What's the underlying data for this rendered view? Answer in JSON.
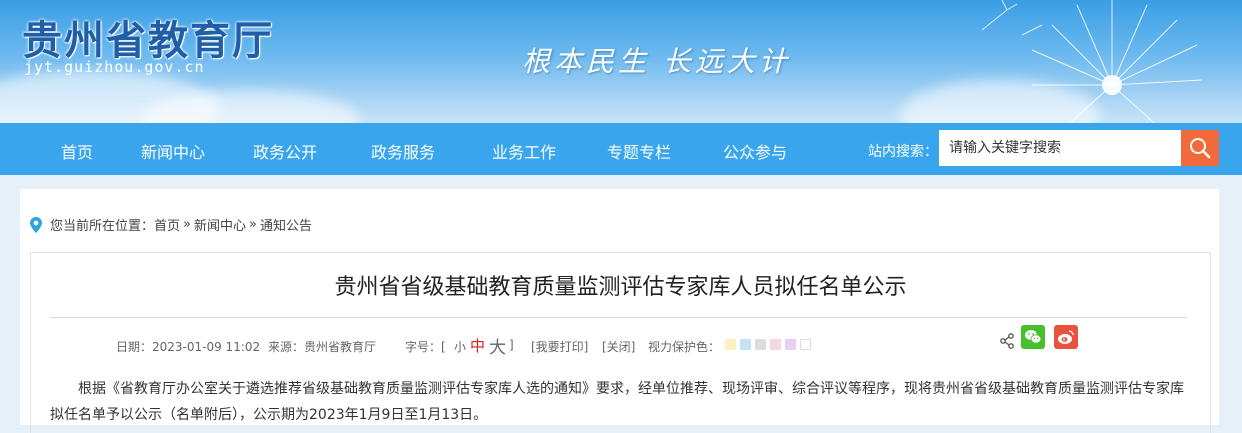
{
  "header": {
    "site_title": "贵州省教育厅",
    "site_domain": "jyt.guizhou.gov.cn",
    "slogan": "根本民生 长远大计"
  },
  "nav": {
    "items": [
      "首页",
      "新闻中心",
      "政务公开",
      "政务服务",
      "业务工作",
      "专题专栏",
      "公众参与"
    ],
    "search_label": "站内搜索：",
    "search_placeholder": "请输入关键字搜索"
  },
  "breadcrumb": {
    "prefix": "您当前所在位置：",
    "items": [
      "首页",
      "新闻中心",
      "通知公告"
    ],
    "separator": "»"
  },
  "article": {
    "title": "贵州省省级基础教育质量监测评估专家库人员拟任名单公示",
    "date": "日期：2023-01-09 11:02",
    "source": "来源：贵州省教育厅",
    "font_size_label": "字号：[",
    "font_small": "小",
    "font_medium": "中",
    "font_large": "大",
    "font_close": "]",
    "print": "[我要打印]",
    "close": "[关闭]",
    "eye_care_label": "视力保护色：",
    "eye_care_colors": [
      "#faf2c5",
      "#c4e3f6",
      "#dcdcdc",
      "#f5d7dd",
      "#e5d2f2",
      "#ffffff"
    ],
    "body": "根据《省教育厅办公室关于遴选推荐省级基础教育质量监测评估专家库人选的通知》要求，经单位推荐、现场评审、综合评议等程序，现将贵州省省级基础教育质量监测评估专家库拟任名单予以公示（名单附后），公示期为2023年1月9日至1月13日。"
  },
  "icons": {
    "search": "search-icon",
    "location": "location-pin-icon",
    "share": "share-icon",
    "wechat": "wechat-icon",
    "weibo": "weibo-icon"
  },
  "colors": {
    "nav_bg": "#39a5ec",
    "search_button": "#f26a3b",
    "font_medium_active": "#e02020",
    "wechat": "#46c02b",
    "weibo": "#e8523f"
  }
}
